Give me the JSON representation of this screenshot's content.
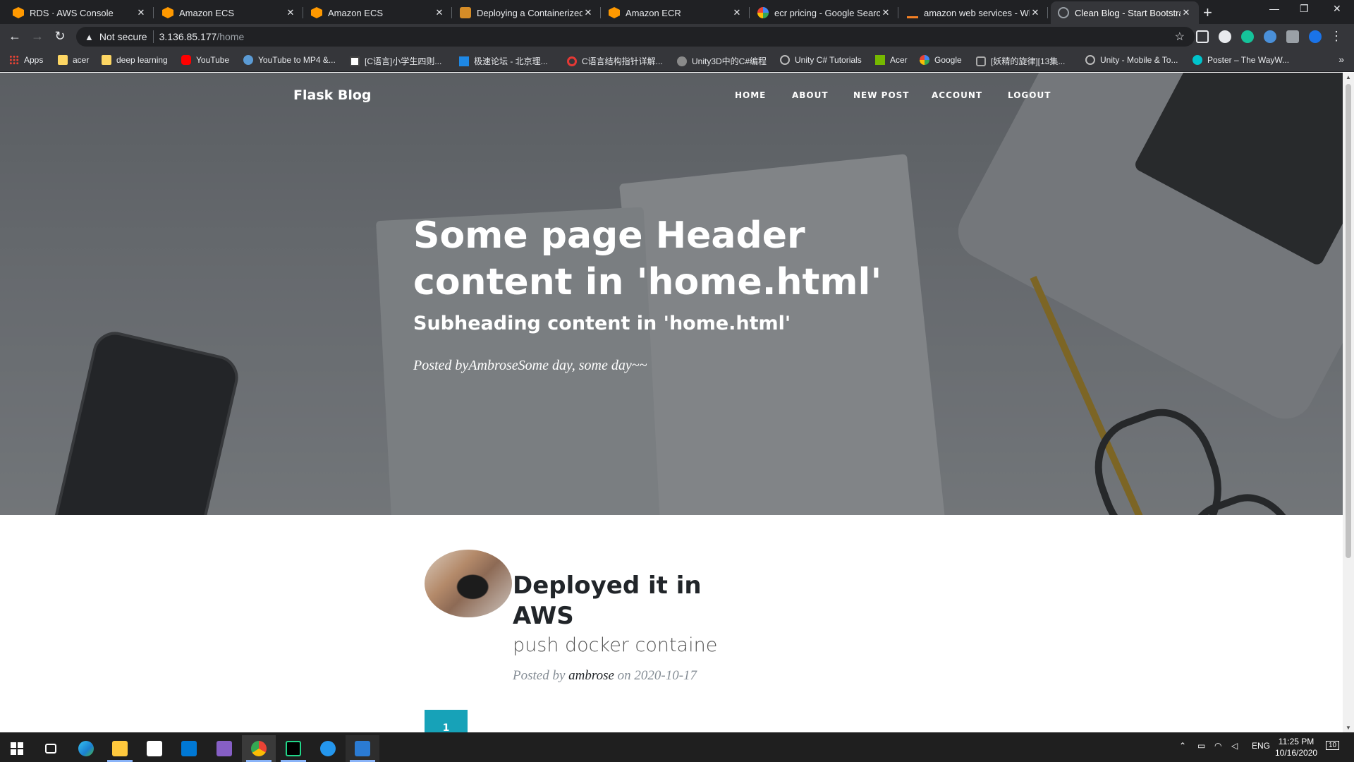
{
  "browser": {
    "tabs": [
      {
        "title": "RDS · AWS Console",
        "favicon": "aws-icon"
      },
      {
        "title": "Amazon ECS",
        "favicon": "aws-icon"
      },
      {
        "title": "Amazon ECS",
        "favicon": "aws-icon"
      },
      {
        "title": "Deploying a Containerized",
        "favicon": "aws-docs-icon"
      },
      {
        "title": "Amazon ECR",
        "favicon": "aws-icon"
      },
      {
        "title": "ecr pricing - Google Search",
        "favicon": "google-icon"
      },
      {
        "title": "amazon web services - Wha",
        "favicon": "stackoverflow-icon"
      },
      {
        "title": "Clean Blog - Start Bootstrap",
        "favicon": "globe-icon",
        "active": true
      }
    ],
    "address": {
      "security": "Not secure",
      "host": "3.136.85.177",
      "path": "/home"
    },
    "bookmarks": [
      {
        "label": "Apps",
        "icon": "apps-icon"
      },
      {
        "label": "acer",
        "icon": "folder-icon"
      },
      {
        "label": "deep learning",
        "icon": "folder-icon"
      },
      {
        "label": "YouTube",
        "icon": "youtube-icon"
      },
      {
        "label": "YouTube to MP4 &...",
        "icon": "converter-icon"
      },
      {
        "label": "[C语言]小学生四则...",
        "icon": "doc-icon"
      },
      {
        "label": "极速论坛 - 北京理...",
        "icon": "forum-icon"
      },
      {
        "label": "C语言结构指针详解...",
        "icon": "c-icon"
      },
      {
        "label": "Unity3D中的C#编程",
        "icon": "site-icon"
      },
      {
        "label": "Unity C# Tutorials",
        "icon": "unity-icon"
      },
      {
        "label": "Acer",
        "icon": "nvidia-icon"
      },
      {
        "label": "Google",
        "icon": "google-icon"
      },
      {
        "label": "[妖精的旋律][13集...",
        "icon": "bilibili-icon"
      },
      {
        "label": "Unity - Mobile & To...",
        "icon": "unity-icon"
      },
      {
        "label": "Poster – The WayW...",
        "icon": "canva-icon"
      }
    ]
  },
  "blog": {
    "brand": "Flask Blog",
    "nav": [
      "HOME",
      "ABOUT",
      "NEW POST",
      "ACCOUNT",
      "LOGOUT"
    ],
    "header": {
      "title": "Some page Header content in 'home.html'",
      "subtitle": "Subheading content in 'home.html'",
      "meta": "Posted byAmbroseSome day, some day~~"
    },
    "post": {
      "title": "Deployed it in AWS",
      "subtitle": "push docker containe",
      "posted_by_label": "Posted by",
      "author": "ambrose",
      "on_label": "on",
      "date": "2020-10-17"
    },
    "pagination": {
      "current": "1"
    }
  },
  "taskbar": {
    "lang": "ENG",
    "time": "11:25 PM",
    "date": "10/16/2020",
    "notifications": "10"
  },
  "colors": {
    "accent": "#17a2b8",
    "chrome_dark": "#202124",
    "chrome_toolbar": "#35363a"
  }
}
